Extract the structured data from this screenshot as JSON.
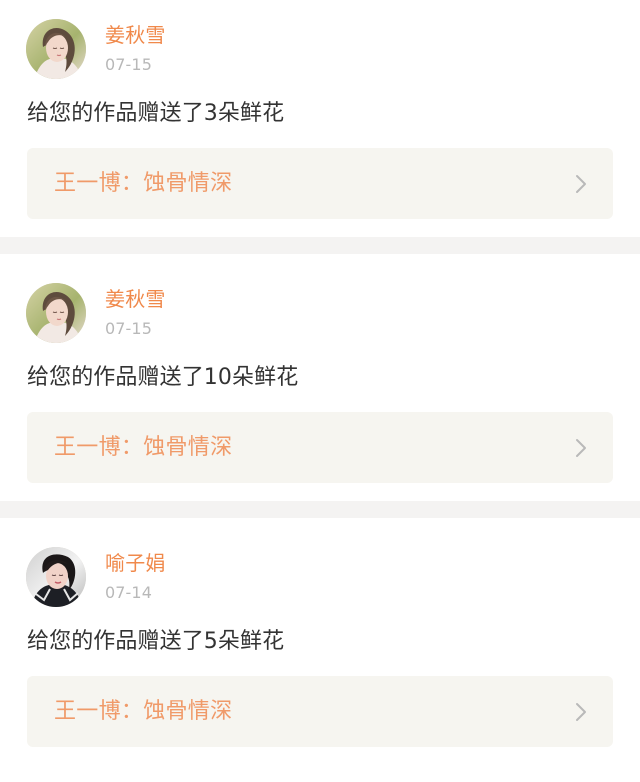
{
  "feed": {
    "items": [
      {
        "username": "姜秋雪",
        "date": "07-15",
        "message": "给您的作品赠送了3朵鲜花",
        "work_title": "王一博：蚀骨情深",
        "avatar_icon": "user-avatar-icon"
      },
      {
        "username": "姜秋雪",
        "date": "07-15",
        "message": "给您的作品赠送了10朵鲜花",
        "work_title": "王一博：蚀骨情深",
        "avatar_icon": "user-avatar-icon"
      },
      {
        "username": "喻子娟",
        "date": "07-14",
        "message": "给您的作品赠送了5朵鲜花",
        "work_title": "王一博：蚀骨情深",
        "avatar_icon": "user-avatar-icon"
      }
    ]
  },
  "colors": {
    "accent_orange": "#f0894b",
    "work_title_orange": "#f09a69",
    "muted_date": "#b8b8b8",
    "text_dark": "#333333",
    "link_background": "#f6f5f0",
    "feed_background": "#f4f3f2"
  },
  "icons": {
    "chevron": "chevron-right-icon",
    "avatar": "user-avatar-icon"
  }
}
